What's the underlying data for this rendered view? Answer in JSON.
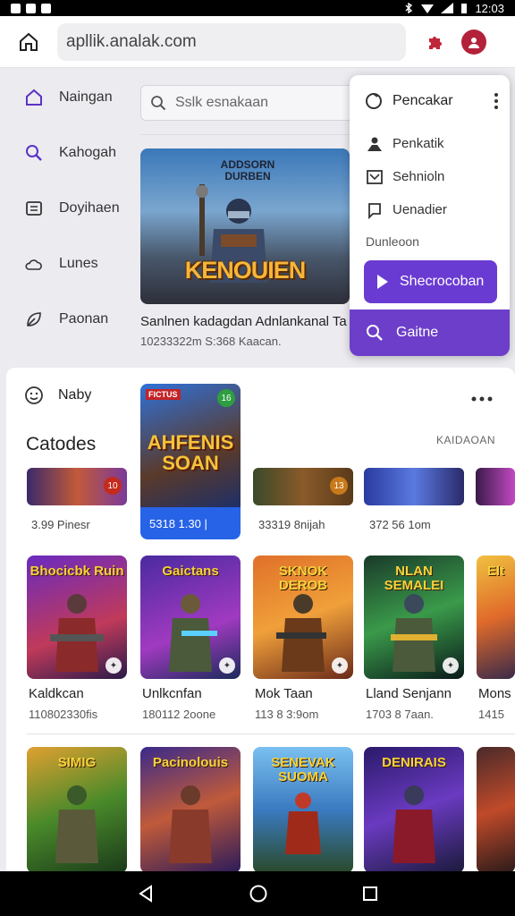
{
  "status_bar": {
    "time": "12:03"
  },
  "browser": {
    "url": "apllik.analak.com"
  },
  "sidebar": {
    "items": [
      {
        "label": "Naingan",
        "icon": "home-icon"
      },
      {
        "label": "Kahogah",
        "icon": "search-icon"
      },
      {
        "label": "Doyihaen",
        "icon": "library-icon"
      },
      {
        "label": "Lunes",
        "icon": "cloud-icon"
      },
      {
        "label": "Paonan",
        "icon": "leaf-icon"
      }
    ]
  },
  "search": {
    "placeholder": "Sslk esnakaan"
  },
  "featured": {
    "subtitle": "ADDSORN DURBEN",
    "title": "KENOUIEN",
    "caption": "Sanlnen kadagdan Adnlankanal Ta",
    "meta": "10233322m S:368 Kaacan."
  },
  "menu": {
    "header": "Pencakar",
    "items": [
      {
        "label": "Penkatik",
        "icon": "people-icon"
      },
      {
        "label": "Sehnioln",
        "icon": "frame-icon"
      },
      {
        "label": "Uenadier",
        "icon": "chat-icon"
      }
    ],
    "section_label": "Dunleoon",
    "cta_label": "Shecrocoban",
    "selected_label": "Gaitne"
  },
  "panel": {
    "header_label": "Naby",
    "section_title": "Catodes",
    "section_right": "KAIDAOAN",
    "featured_card": {
      "mini_tag": "FICTUS",
      "badge": "16",
      "title": "AHFENIS SOAN",
      "meta": "5318 1.30 |"
    },
    "row1": [
      {
        "meta": "3.99 Pinesr",
        "badge": "10"
      },
      {
        "meta": "33319 8nijah",
        "badge": "13"
      },
      {
        "meta": "372 56 1om",
        "badge": ""
      },
      {
        "meta": "",
        "badge": ""
      }
    ],
    "row2": [
      {
        "art_title": "Bhocicbk Ruin",
        "title": "Kaldkcan",
        "meta": "110802330fis"
      },
      {
        "art_title": "Gaictans",
        "title": "Unlkcnfan",
        "meta": "180112 2oone"
      },
      {
        "art_title": "SKNOK DEROB",
        "title": "Mok Taan",
        "meta": "113 8 3:9om"
      },
      {
        "art_title": "NLAN SEMALEI",
        "title": "Lland Senjann",
        "meta": "1703 8 7aan."
      },
      {
        "art_title": "Elt",
        "title": "Mons",
        "meta": "1415"
      }
    ],
    "row3": [
      {
        "art_title": "SIMIG"
      },
      {
        "art_title": "Pacinolouis"
      },
      {
        "art_title": "SENEVAK SUOMA"
      },
      {
        "art_title": "DENIRAIS"
      },
      {
        "art_title": ""
      }
    ]
  },
  "colors": {
    "accent": "#6a3bd2",
    "featured_blue": "#2763e6"
  }
}
